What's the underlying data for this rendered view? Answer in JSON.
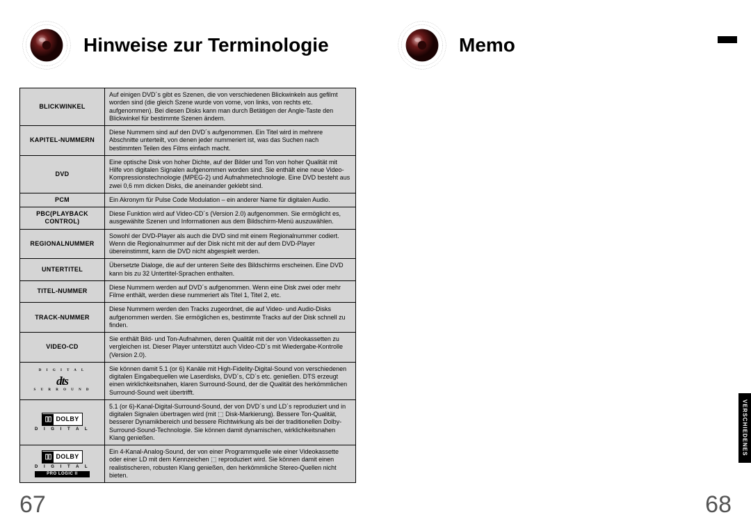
{
  "left": {
    "title": "Hinweise zur Terminologie",
    "page_number": "67",
    "rows": [
      {
        "label": "BLICKWINKEL",
        "desc": "Auf einigen DVD´s gibt es Szenen, die von verschiedenen Blickwinkeln aus gefilmt worden sind (die gleich Szene wurde von vorne, von links, von rechts etc. aufgenommen). Bei diesen Disks kann man durch Betätigen der Angle-Taste den Blickwinkel für bestimmte Szenen ändern."
      },
      {
        "label": "KAPITEL-NUMMERN",
        "desc": "Diese Nummern sind auf den DVD´s aufgenommen. Ein Titel wird in mehrere Abschnitte unterteilt, von denen jeder nummeriert ist, was das Suchen nach bestimmten Teilen des Films einfach macht."
      },
      {
        "label": "DVD",
        "desc": "Eine optische Disk von hoher Dichte, auf der Bilder und Ton von hoher Qualität mit Hilfe von digitalen Signalen aufgenommen worden sind. Sie enthält eine neue Video-Kompressionstechnologie (MPEG-2) und Aufnahmetechnologie. Eine DVD besteht aus zwei 0,6 mm dicken Disks, die aneinander geklebt sind."
      },
      {
        "label": "PCM",
        "desc": "Ein Akronym für Pulse Code Modulation – ein anderer Name für digitalen Audio."
      },
      {
        "label": "PBC(PLAYBACK CONTROL)",
        "desc": "Diese Funktion wird auf Video-CD´s (Version 2.0) aufgenommen. Sie ermöglicht es, ausgewählte Szenen und Informationen aus dem Bildschirm-Menü auszuwählen."
      },
      {
        "label": "REGIONALNUMMER",
        "desc": "Sowohl der DVD-Player als auch die DVD sind mit einem Regionalnummer codiert. Wenn die Regionalnummer auf der Disk nicht mit der auf dem DVD-Player übereinstimmt, kann die DVD nicht abgespielt werden."
      },
      {
        "label": "UNTERTITEL",
        "desc": "Übersetzte Dialoge, die auf der unteren Seite des Bildschirms erscheinen. Eine DVD kann bis zu 32 Untertitel-Sprachen enthalten."
      },
      {
        "label": "TITEL-NUMMER",
        "desc": "Diese Nummern werden auf DVD´s aufgenommen. Wenn eine Disk zwei oder mehr Filme enthält, werden diese nummeriert als Titel 1, Titel 2, etc."
      },
      {
        "label": "TRACK-NUMMER",
        "desc": "Diese Nummern werden den Tracks zugeordnet, die auf Video- und Audio-Disks aufgenommen werden. Sie ermöglichen es, bestimmte Tracks auf der Disk schnell zu finden."
      },
      {
        "label": "VIDEO-CD",
        "desc": "Sie enthält Bild- und Ton-Aufnahmen, deren Qualität mit der von Videokassetten zu vergleichen ist. Dieser Player unterstützt auch Video-CD´s mit Wiedergabe-Kontrolle (Version 2.0)."
      },
      {
        "label": "dts",
        "desc": "Sie können damit 5.1 (or 6) Kanäle mit High-Fidelity-Digital-Sound von verschiedenen digitalen Eingabequellen wie Laserdisks, DVD´s, CD´s etc. genießen. DTS erzeugt einen wirklichkeitsnahen, klaren Surround-Sound, der die Qualität des herkömmlichen Surround-Sound weit übertrifft."
      },
      {
        "label": "dolby_digital",
        "desc": "5.1 (or 6)-Kanal-Digital-Surround-Sound, der von DVD´s und LD´s reproduziert und in digitalen Signalen übertragen wird (mit ⬚ Disk-Markierung). Bessere Ton-Qualität, besserer Dynamikbereich und bessere Richtwirkung als bei der traditionellen Dolby-Surround-Sound-Technologie. Sie können damit dynamischen, wirklichkeitsnahen Klang genießen."
      },
      {
        "label": "dolby_prologic",
        "desc": "Ein 4-Kanal-Analog-Sound, der von einer Programmquelle wie einer Videokassette oder einer LD mit dem Kennzeichen ⬚ reproduziert wird. Sie können damit einen realistischeren, robusten Klang genießen, den herkömmliche Stereo-Quellen nicht bieten."
      }
    ]
  },
  "right": {
    "title": "Memo",
    "page_number": "68",
    "side_tab": "VERSCHIEDENES"
  },
  "logos": {
    "dts_top": "D I G I T A L",
    "dts_mid": "dts",
    "dts_bot": "S U R R O U N D",
    "dolby": "DOLBY",
    "digital": "D I G I T A L",
    "prologic": "PRO LOGIC II"
  }
}
